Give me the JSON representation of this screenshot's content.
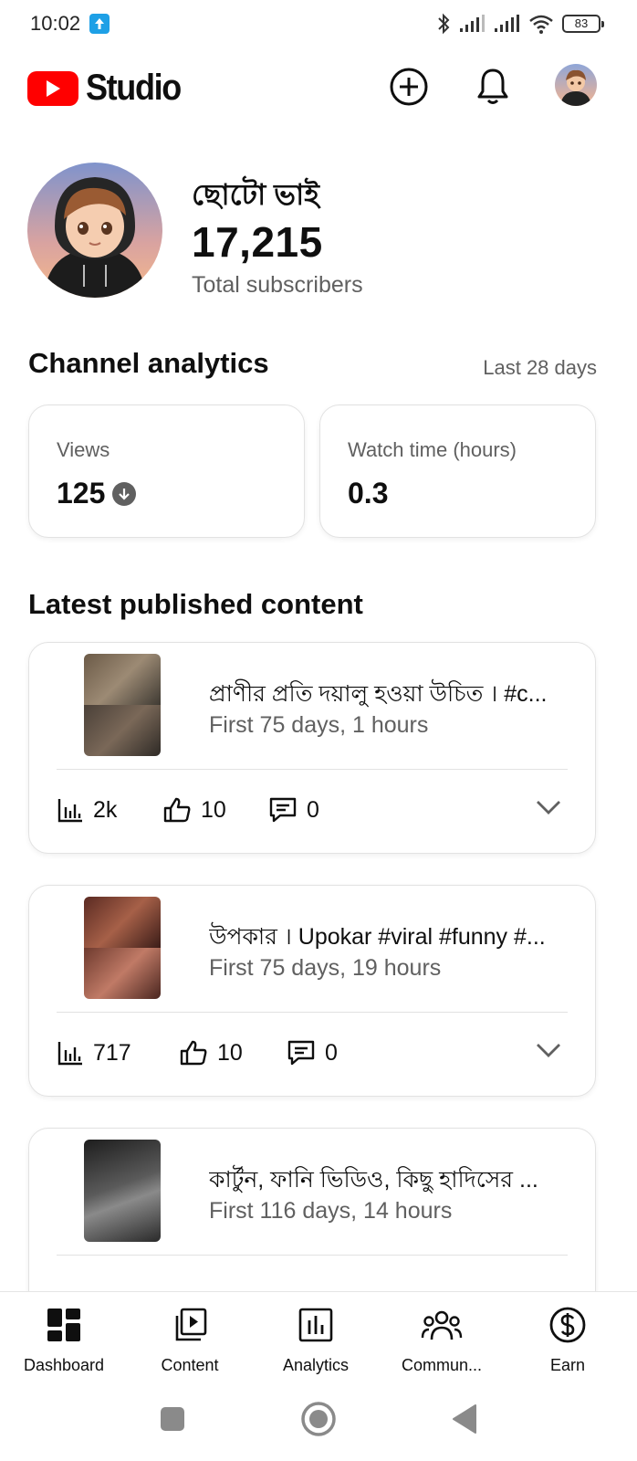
{
  "status_bar": {
    "time": "10:02",
    "battery": "83"
  },
  "header": {
    "logo_text": "Studio",
    "brand_color": "#ff0000",
    "icons": [
      "create-icon",
      "notifications-bell-icon",
      "account-avatar"
    ]
  },
  "channel": {
    "name": "ছোটো ভাই",
    "subscriber_count": "17,215",
    "subscriber_label": "Total subscribers"
  },
  "analytics": {
    "title": "Channel analytics",
    "period": "Last 28 days",
    "metrics": [
      {
        "label": "Views",
        "value": "125",
        "trend": "down"
      },
      {
        "label": "Watch time (hours)",
        "value": "0.3"
      }
    ]
  },
  "latest": {
    "title": "Latest published content",
    "items": [
      {
        "title": "প্রাণীর প্রতি দয়ালু হওয়া উচিত । #c...",
        "subtitle": "First 75 days, 1 hours",
        "views": "2k",
        "likes": "10",
        "comments": "0"
      },
      {
        "title": "উপকার । Upokar #viral #funny #...",
        "subtitle": "First 75 days, 19 hours",
        "views": "717",
        "likes": "10",
        "comments": "0"
      },
      {
        "title": "কার্টুন, ফানি ভিডিও, কিছু হাদিসের ...",
        "subtitle": "First 116 days, 14 hours"
      }
    ]
  },
  "bottom_nav": [
    {
      "label": "Dashboard",
      "icon": "dashboard-icon",
      "active": true
    },
    {
      "label": "Content",
      "icon": "content-icon"
    },
    {
      "label": "Analytics",
      "icon": "analytics-icon"
    },
    {
      "label": "Commun...",
      "icon": "community-icon"
    },
    {
      "label": "Earn",
      "icon": "earn-icon"
    }
  ]
}
